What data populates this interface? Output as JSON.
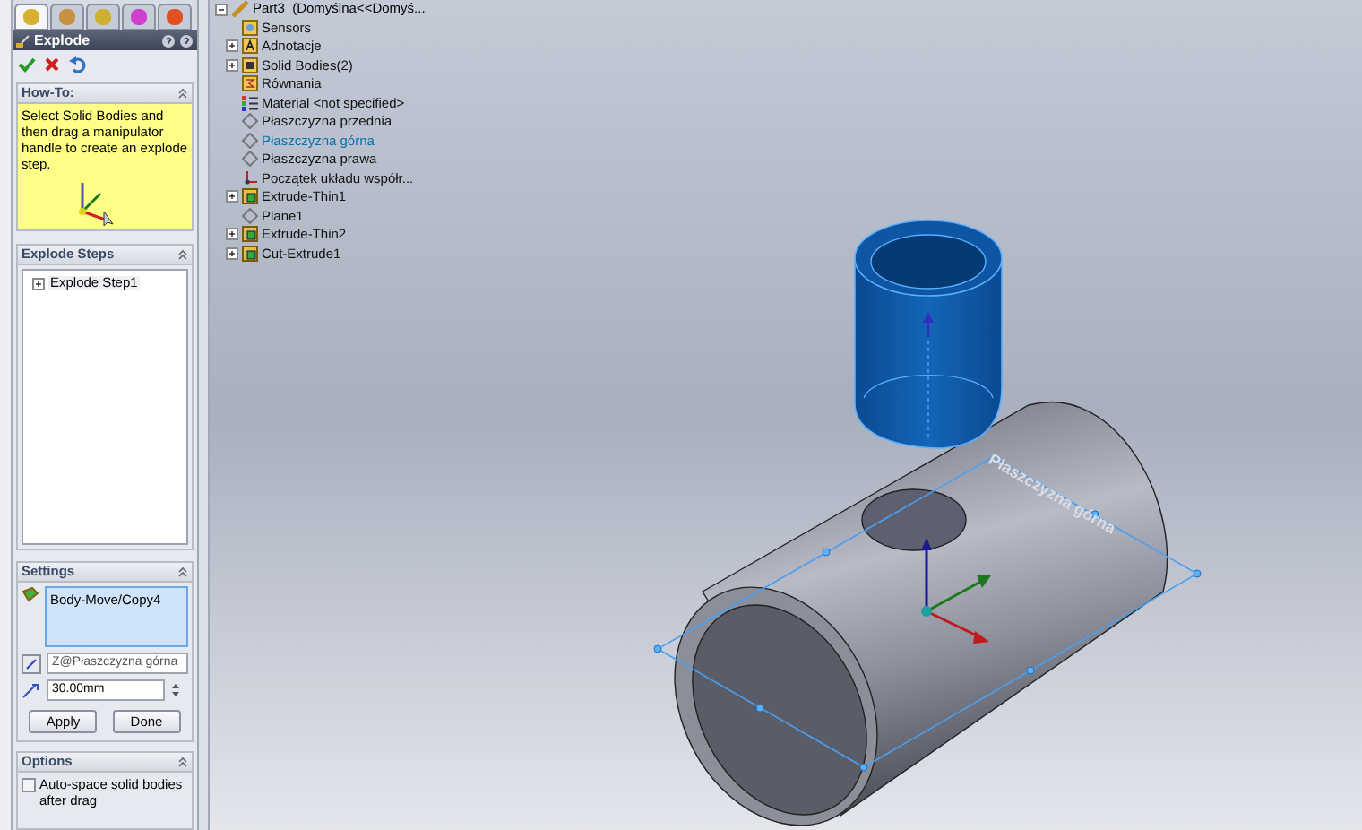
{
  "property_manager": {
    "title": "Explode"
  },
  "howto": {
    "title": "How-To:",
    "text": "Select Solid Bodies and then drag a manipulator handle to create an explode step."
  },
  "explode_steps": {
    "title": "Explode Steps",
    "items": [
      {
        "label": "Explode Step1",
        "expanded": false
      }
    ]
  },
  "settings": {
    "title": "Settings",
    "bodies": [
      "Body-Move/Copy4"
    ],
    "direction": "Z@Płaszczyzna górna",
    "distance": "30.00mm",
    "buttons": [
      "Apply",
      "Done"
    ]
  },
  "options": {
    "title": "Options",
    "items": [
      {
        "label": "Auto-space solid bodies after drag",
        "checked": false
      }
    ]
  },
  "tree": {
    "root": {
      "label": "Part3  (Domyślna<<Domyś...",
      "expanded": true,
      "children": [
        {
          "label": "Sensors",
          "kind": "sensor",
          "expander": false,
          "selected": false
        },
        {
          "label": "Adnotacje",
          "kind": "annotation",
          "expander": true,
          "selected": false
        },
        {
          "label": "Solid Bodies(2)",
          "kind": "bodies",
          "expander": true,
          "selected": false
        },
        {
          "label": "Równania",
          "kind": "equations",
          "expander": false,
          "selected": false
        },
        {
          "label": "Material <not specified>",
          "kind": "material",
          "expander": false,
          "selected": false
        },
        {
          "label": "Płaszczyzna przednia",
          "kind": "plane",
          "expander": false,
          "selected": false
        },
        {
          "label": "Płaszczyzna górna",
          "kind": "plane",
          "expander": false,
          "selected": true
        },
        {
          "label": "Płaszczyzna prawa",
          "kind": "plane",
          "expander": false,
          "selected": false
        },
        {
          "label": "Początek układu współr...",
          "kind": "origin",
          "expander": false,
          "selected": false
        },
        {
          "label": "Extrude-Thin1",
          "kind": "feature",
          "expander": true,
          "selected": false
        },
        {
          "label": "Plane1",
          "kind": "plane",
          "expander": false,
          "selected": false
        },
        {
          "label": "Extrude-Thin2",
          "kind": "feature",
          "expander": true,
          "selected": false
        },
        {
          "label": "Cut-Extrude1",
          "kind": "feature",
          "expander": true,
          "selected": false
        }
      ]
    }
  },
  "viewport": {
    "plane_label": "Płaszczyzna górna"
  }
}
